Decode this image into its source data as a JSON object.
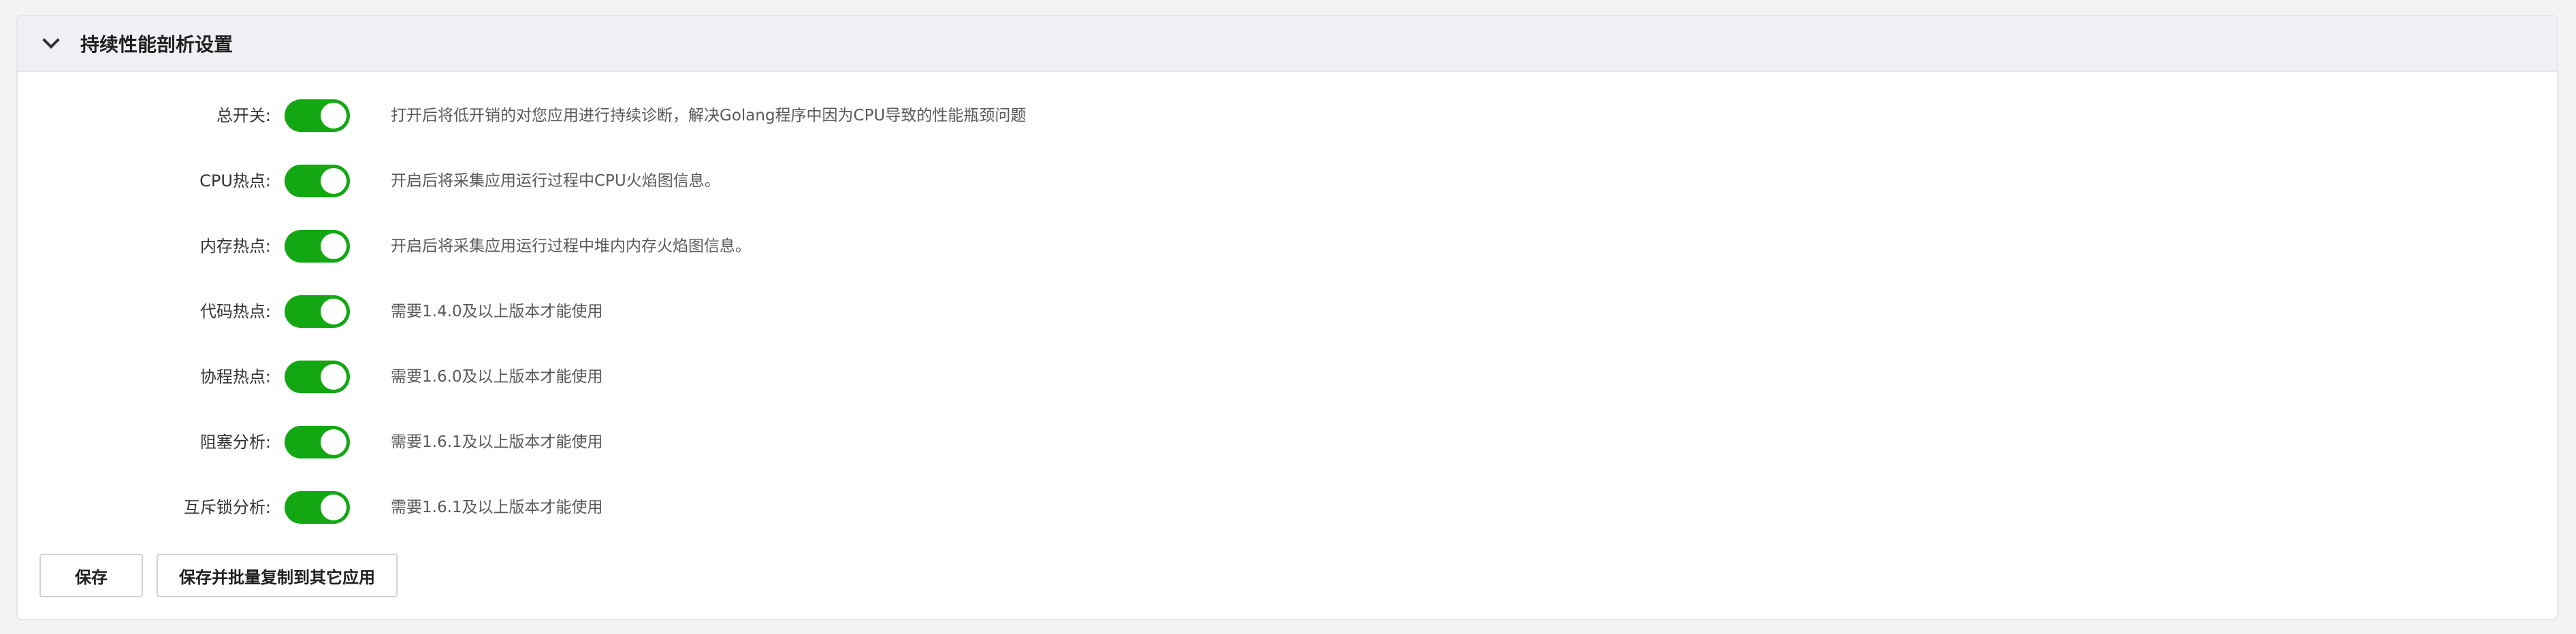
{
  "section": {
    "title": "持续性能剖析设置",
    "collapse_icon": "chevron-down-icon"
  },
  "settings": [
    {
      "label": "总开关:",
      "enabled": true,
      "description": "打开后将低开销的对您应用进行持续诊断，解决Golang程序中因为CPU导致的性能瓶颈问题"
    },
    {
      "label": "CPU热点:",
      "enabled": true,
      "description": "开启后将采集应用运行过程中CPU火焰图信息。"
    },
    {
      "label": "内存热点:",
      "enabled": true,
      "description": "开启后将采集应用运行过程中堆内内存火焰图信息。"
    },
    {
      "label": "代码热点:",
      "enabled": true,
      "description": "需要1.4.0及以上版本才能使用"
    },
    {
      "label": "协程热点:",
      "enabled": true,
      "description": "需要1.6.0及以上版本才能使用"
    },
    {
      "label": "阻塞分析:",
      "enabled": true,
      "description": "需要1.6.1及以上版本才能使用"
    },
    {
      "label": "互斥锁分析:",
      "enabled": true,
      "description": "需要1.6.1及以上版本才能使用"
    }
  ],
  "actions": {
    "save_label": "保存",
    "save_copy_label": "保存并批量复制到其它应用"
  },
  "colors": {
    "toggle_on": "#13a813",
    "header_bg": "#eef0f3"
  }
}
